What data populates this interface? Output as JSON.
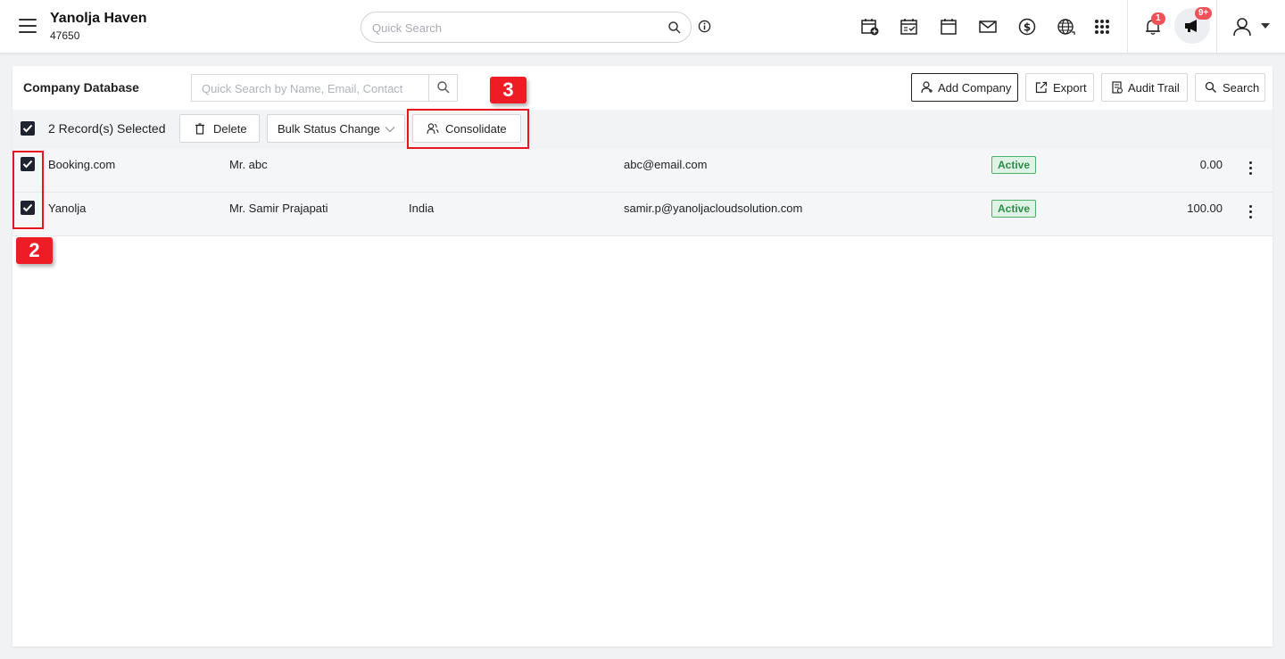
{
  "header": {
    "property_name": "Yanolja Haven",
    "property_id": "47650",
    "quick_search_placeholder": "Quick Search",
    "notification_count": "1",
    "announcement_count": "9+",
    "toolbar_icons": [
      "calendar-add-icon",
      "calendar-check-icon",
      "calendar-icon",
      "mail-icon",
      "dollar-icon",
      "globe-icon",
      "apps-grid-icon"
    ]
  },
  "panel": {
    "title": "Company Database",
    "search_placeholder": "Quick Search by Name, Email, Contact",
    "buttons": {
      "add_company": "Add Company",
      "export": "Export",
      "audit_trail": "Audit Trail",
      "search": "Search"
    }
  },
  "selection": {
    "label": "2 Record(s) Selected",
    "delete": "Delete",
    "bulk_status": "Bulk Status Change",
    "consolidate": "Consolidate"
  },
  "rows": [
    {
      "name": "Booking.com",
      "contact": "Mr. abc",
      "country": "",
      "email": "abc@email.com",
      "status": "Active",
      "amount": "0.00",
      "checked": true
    },
    {
      "name": "Yanolja",
      "contact": "Mr. Samir Prajapati",
      "country": "India",
      "email": "samir.p@yanoljacloudsolution.com",
      "status": "Active",
      "amount": "100.00",
      "checked": true
    }
  ],
  "annotations": {
    "step_2": "2",
    "step_3": "3"
  },
  "colors": {
    "accent_dark": "#1f2330",
    "status_green": "#2e8b4a",
    "annotation_red": "#ee1c25",
    "badge_red": "#f0525a"
  }
}
